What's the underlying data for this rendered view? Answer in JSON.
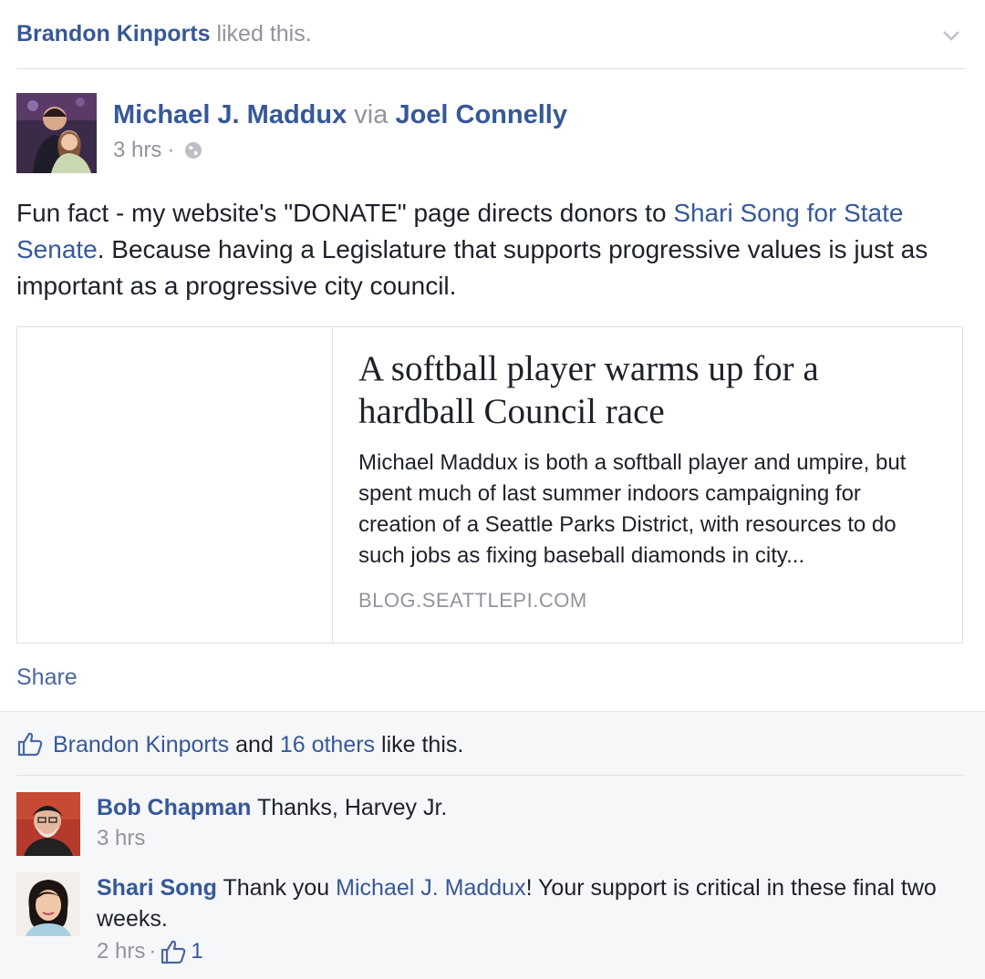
{
  "story": {
    "actor": "Brandon Kinports",
    "action": "liked this."
  },
  "post": {
    "author": "Michael J. Maddux",
    "via_word": "via",
    "via_name": "Joel Connelly",
    "time": "3 hrs",
    "separator": "·",
    "audience_icon": "globe-icon",
    "text_part1": "Fun fact - my website's \"DONATE\" page directs donors to ",
    "text_link": "Shari Song for State Senate",
    "text_part2": ". Because having a Legislature that supports progressive values is just as important as a progressive city council."
  },
  "link_card": {
    "title": "A softball player warms up for a hardball Council race",
    "description": "Michael Maddux is both a softball player and umpire, but spent much of last summer indoors campaigning for creation of a Seattle Parks District, with resources to do such jobs as fixing baseball diamonds in city...",
    "domain": "BLOG.SEATTLEPI.COM"
  },
  "actions": {
    "share_label": "Share"
  },
  "likes": {
    "icon": "thumbs-up-icon",
    "name": "Brandon Kinports",
    "and": "and",
    "others": "16 others",
    "suffix": "like this."
  },
  "comments": [
    {
      "author": "Bob Chapman",
      "text": "Thanks, Harvey Jr.",
      "time": "3 hrs"
    },
    {
      "author": "Shari Song",
      "text_part1": "Thank you ",
      "mention": "Michael J. Maddux",
      "text_part2": "! Your support is critical in these final two weeks.",
      "time": "2 hrs",
      "separator": "·",
      "like_count": "1"
    }
  ],
  "colors": {
    "link": "#365899",
    "muted": "#90949c",
    "ufi_background": "#f6f7f9"
  }
}
